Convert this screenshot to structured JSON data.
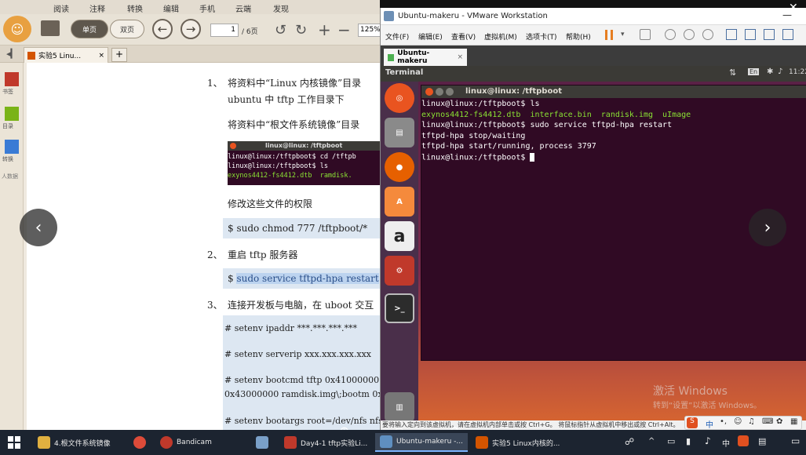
{
  "reader": {
    "menu": [
      "阅读",
      "注释",
      "转换",
      "编辑",
      "手机",
      "云端",
      "发现"
    ],
    "toolbar": {
      "single": "单页",
      "double": "双页",
      "page_current": "1",
      "page_total": "/ 6页",
      "zoom": "125%"
    },
    "tab": {
      "title": "实验5 Linu...",
      "close": "×",
      "add": "+"
    },
    "side": [
      "书签",
      "目录",
      "转换",
      "人数据"
    ],
    "doc": {
      "s1_num": "1、",
      "s1_a": "将资料中“Linux 内核镜像”目录",
      "s1_b": "ubuntu 中 tftp 工作目录下",
      "s1_c": "将资料中“根文件系统镜像”目录",
      "mini_title": "linux@linux: /tftpboot",
      "mini_l1": "linux@linux:/tftpboot$ cd /tftpb",
      "mini_l2": "linux@linux:/tftpboot$ ls",
      "mini_l3": "exynos4412-fs4412.dtb  ramdisk.",
      "perm": "修改这些文件的权限",
      "cmd1": "$ sudo    chmod    777    /tftpboot/*",
      "s2_num": "2、",
      "s2": "重启 tftp 服务器",
      "cmd2_a": "$ ",
      "cmd2_b": "sudo    service    tftpd-hpa    restart",
      "s3_num": "3、",
      "s3": "连接开发板与电脑，在 uboot 交互",
      "env1": "# setenv ipaddr ***.***.***.***",
      "env2": "# setenv serverip xxx.xxx.xxx.xxx",
      "env3a": "# setenv bootcmd tftp 0x41000000 ul",
      "env3b": "0x43000000 ramdisk.img\\;bootm 0x4",
      "env4": "# setenv bootargs root=/dev/nfs nfsro"
    }
  },
  "vmware": {
    "title": "Ubuntu-makeru - VMware Workstation",
    "menu": [
      "文件(F)",
      "编辑(E)",
      "查看(V)",
      "虚拟机(M)",
      "选项卡(T)",
      "帮助(H)"
    ],
    "tab": "Ubuntu-makeru",
    "ubuntu_app": "Terminal",
    "indicators": {
      "lang": "En",
      "time": "11:22"
    },
    "terminal": {
      "title": "linux@linux: /tftpboot",
      "lines": [
        {
          "t": "linux@linux:/tftpboot$ ls",
          "c": ""
        },
        {
          "t": "exynos4412-fs4412.dtb  interface.bin  randisk.img  uImage",
          "c": "g"
        },
        {
          "t": "linux@linux:/tftpboot$ sudo service tftpd-hpa restart",
          "c": ""
        },
        {
          "t": "tftpd-hpa stop/waiting",
          "c": ""
        },
        {
          "t": "tftpd-hpa start/running, process 3797",
          "c": ""
        },
        {
          "t": "linux@linux:/tftpboot$ ",
          "c": ""
        }
      ]
    },
    "status": "要将输入定向到该虚拟机，请在虚拟机内部单击或按 Ctrl+G。",
    "status_hint": "将鼠标指针从虚拟机中移出或按 Ctrl+Alt。"
  },
  "watermark": {
    "line1": "激活 Windows",
    "line2": "转到“设置”以激活 Windows。"
  },
  "taskbar": {
    "items": [
      {
        "label": "4.根文件系统镜像",
        "color": "#e0b040"
      },
      {
        "label": "",
        "color": "#dd4b39"
      },
      {
        "label": "Bandicam",
        "color": "#c0392b"
      },
      {
        "label": "",
        "color": "#7aa0c8"
      },
      {
        "label": "Day4-1 tftp实验Li...",
        "color": "#c0392b"
      },
      {
        "label": "Ubuntu-makeru -...",
        "color": "#5f8fc0"
      },
      {
        "label": "实验5 Linux内核的...",
        "color": "#d35400"
      }
    ],
    "tray": {
      "ime_cn": "中",
      "time": "",
      "date": ""
    }
  }
}
